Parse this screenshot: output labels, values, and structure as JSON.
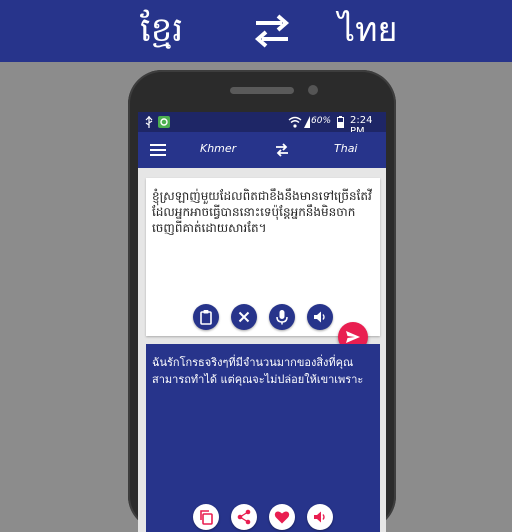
{
  "banner": {
    "source_lang": "ខ្មែរ",
    "target_lang": "ไทย"
  },
  "statusbar": {
    "battery": "60%",
    "time": "2:24 PM"
  },
  "toolbar": {
    "source_label": "Khmer",
    "target_label": "Thai"
  },
  "input": {
    "text": "ខ្ញុំស្រឡាញ់មួយដែលពិតជាខឹងនឹងមានទៅច្រើនតែវីដែលអ្នកអាចធ្វើបាននោះទេប៉ុន្តែអ្នកនឹងមិនចាកចេញពីគាត់ដោយសារតែ។"
  },
  "output": {
    "text": "ฉันรักโกรธจริงๆที่มีจำนวนมากของสิ่งที่คุณสามารถทำได้ แต่คุณจะไม่ปล่อยให้เขาเพราะ"
  },
  "colors": {
    "primary": "#27348b",
    "accent": "#e91e50",
    "background": "#8c8c8c"
  },
  "icons": {
    "input_actions": [
      "clipboard-icon",
      "close-icon",
      "mic-icon",
      "speaker-icon"
    ],
    "output_actions": [
      "copy-icon",
      "share-icon",
      "heart-icon",
      "speaker-icon"
    ],
    "fab": "send-icon"
  }
}
